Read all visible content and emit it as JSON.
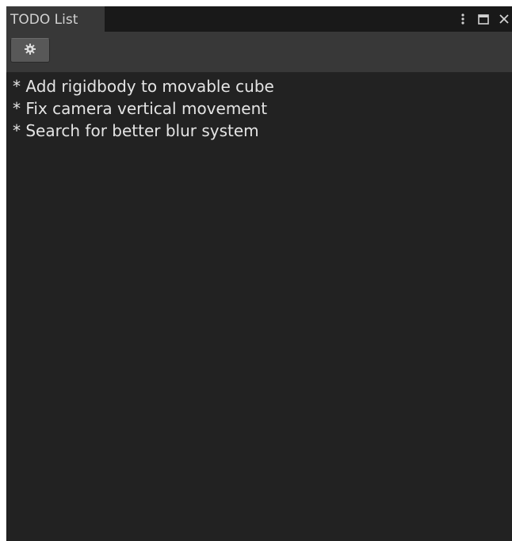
{
  "window": {
    "tab_title": "TODO List",
    "controls": {
      "menu_icon": "vertical-ellipsis-icon",
      "maximize_icon": "maximize-icon",
      "close_icon": "close-icon"
    }
  },
  "toolbar": {
    "settings_icon": "gear-icon"
  },
  "todo": {
    "items": [
      "* Add rigidbody to movable cube",
      "* Fix camera vertical movement",
      "* Search for better blur system"
    ]
  },
  "colors": {
    "background": "#222222",
    "tab": "#383838",
    "toolbar": "#383838",
    "text": "#e4e4e4"
  }
}
